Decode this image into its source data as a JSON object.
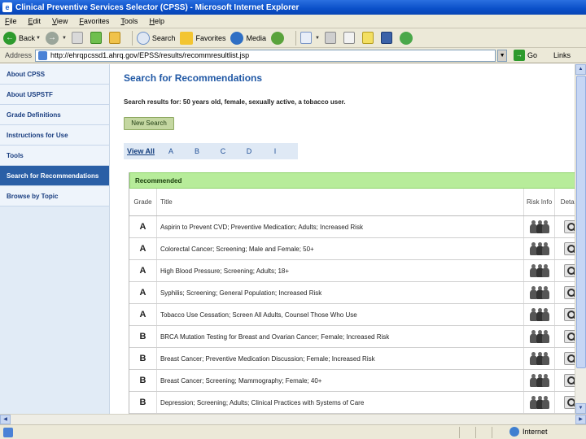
{
  "window": {
    "title": "Clinical Preventive Services Selector (CPSS) - Microsoft Internet Explorer"
  },
  "menu": [
    "File",
    "Edit",
    "View",
    "Favorites",
    "Tools",
    "Help"
  ],
  "toolbar": {
    "back_label": "Back",
    "search_label": "Search",
    "favorites_label": "Favorites",
    "media_label": "Media"
  },
  "addressbar": {
    "label": "Address",
    "url": "http://ehrqpcssd1.ahrq.gov/EPSS/results/recommresultlist.jsp",
    "go_label": "Go",
    "links_label": "Links"
  },
  "sidebar": {
    "items": [
      {
        "label": "About CPSS",
        "active": false
      },
      {
        "label": "About USPSTF",
        "active": false
      },
      {
        "label": "Grade Definitions",
        "active": false
      },
      {
        "label": "Instructions for Use",
        "active": false
      },
      {
        "label": "Tools",
        "active": false
      },
      {
        "label": "Search for Recommendations",
        "active": true
      },
      {
        "label": "Browse by Topic",
        "active": false
      }
    ]
  },
  "main": {
    "title": "Search for Recommendations",
    "results_text": "Search results for: 50 years old, female, sexually active, a tobacco user.",
    "new_search_label": "New Search",
    "tabs": [
      "View All",
      "A",
      "B",
      "C",
      "D",
      "I"
    ]
  },
  "table": {
    "section_header": "Recommended",
    "columns": {
      "grade": "Grade",
      "title": "Title",
      "risk": "Risk Info",
      "details": "Details"
    },
    "rows": [
      {
        "grade": "A",
        "title": "Aspirin to Prevent CVD; Preventive Medication; Adults; Increased Risk"
      },
      {
        "grade": "A",
        "title": "Colorectal Cancer; Screening; Male and Female; 50+"
      },
      {
        "grade": "A",
        "title": "High Blood Pressure; Screening; Adults; 18+"
      },
      {
        "grade": "A",
        "title": "Syphilis; Screening; General Population; Increased Risk"
      },
      {
        "grade": "A",
        "title": "Tobacco Use Cessation; Screen All Adults, Counsel Those Who Use"
      },
      {
        "grade": "B",
        "title": "BRCA Mutation Testing for Breast and Ovarian Cancer; Female; Increased Risk"
      },
      {
        "grade": "B",
        "title": "Breast Cancer; Preventive Medication Discussion; Female; Increased Risk"
      },
      {
        "grade": "B",
        "title": "Breast Cancer; Screening; Mammography; Female; 40+"
      },
      {
        "grade": "B",
        "title": "Depression; Screening; Adults; Clinical Practices with Systems of Care"
      }
    ]
  },
  "statusbar": {
    "zone": "Internet"
  }
}
